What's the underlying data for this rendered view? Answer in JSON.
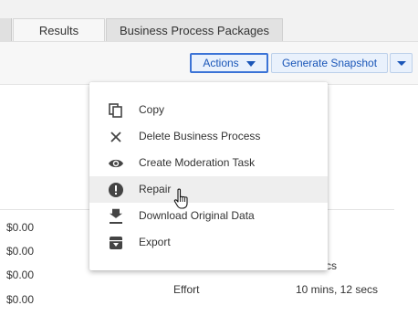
{
  "tabs": [
    "Results",
    "Business Process Packages"
  ],
  "toolbar": {
    "actions_label": "Actions",
    "snapshot_label": "Generate Snapshot"
  },
  "table": {
    "money_values": [
      "$0.00",
      "$0.00",
      "$0.00",
      "$0.00"
    ],
    "partial_right": "cs",
    "effort_label": "Effort",
    "effort_value": "10 mins, 12 secs"
  },
  "menu": {
    "items": [
      {
        "label": "Copy",
        "icon": "copy-icon"
      },
      {
        "label": "Delete Business Process",
        "icon": "close-icon"
      },
      {
        "label": "Create Moderation Task",
        "icon": "eye-icon"
      },
      {
        "label": "Repair",
        "icon": "exclamation-icon",
        "hovered": true
      },
      {
        "label": "Download Original Data",
        "icon": "download-icon"
      },
      {
        "label": "Export",
        "icon": "export-icon"
      }
    ]
  },
  "colors": {
    "accent": "#1a56b8",
    "button_bg": "#e9f1fc",
    "hover_bg": "#eeeeee",
    "icon": "#444444"
  }
}
